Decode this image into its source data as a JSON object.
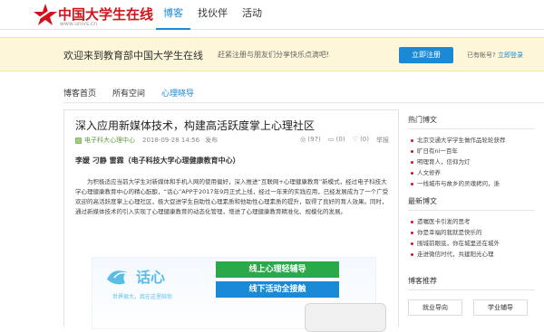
{
  "header": {
    "brand": "中国大学生在线",
    "url": "www.univs.cn",
    "nav": [
      {
        "label": "博客",
        "active": true
      },
      {
        "label": "找伙伴",
        "active": false
      },
      {
        "label": "活动",
        "active": false
      }
    ]
  },
  "banner": {
    "welcome": "欢迎来到教育部中国大学生在线",
    "subtext": "赶紧注册与朋友们分享快乐点滴吧!",
    "register_label": "立即注册",
    "login_prefix": "已有帐号?",
    "login_link": "立即登录"
  },
  "subnav": [
    {
      "label": "博客首页",
      "active": false
    },
    {
      "label": "所有空间",
      "active": false
    },
    {
      "label": "心理晓导",
      "active": true
    }
  ],
  "article": {
    "title": "深入应用新媒体技术，构建高活跃度掌上心理社区",
    "category": "电子科大心理中心",
    "date": "2018-09-28 14:56",
    "publish_label": "发布",
    "views": "(97)",
    "comments": "(0)",
    "likes": "(0)",
    "report_label": "举报",
    "authors": "李媛  刁静  雷霖（电子科技大学心理健康教育中心）",
    "body": "为积极适应当前大学生对新媒体和手机人网的使用偏好，深入推进“互联网+心理健康教育”新模式，经过电子科技大学心理健康教育中心的精心酝酿，“话心”APP于2017年9月正式上线，经过一年来的实践应用，已经发展成为了一个广受欢迎的高活跃度掌上心理社区，极大促进学生自助性心理素质和他助性心理素质的提升，取得了良好的育人效果。同时，通过新媒体技术的引入实现了心理健康教育的动态化管理，增进了心理健康教育精准化、规模化的发展。",
    "figure": {
      "app_name": "话心",
      "tagline": "世界很大，我在这里陪你",
      "btn_online": "线上心理轻辅导",
      "btn_offline": "线下活动全接触"
    }
  },
  "sidebar": {
    "hot_title": "热门博文",
    "hot": [
      "北京交通大学学生做作品轮轮获荐",
      "旷日有ni一百年",
      "明理育人，信仰为灯",
      "人文修养",
      "一线城市与故乡的灵魂拷问，浙"
    ],
    "latest_title": "最新博文",
    "latest": [
      "遗嘱医卡引发的思考",
      "你是幸福的我就是快乐的",
      "围城前眼底，你在城里还在城外",
      "走进微信时代，共建阳光心理"
    ],
    "rec_title": "博客推荐",
    "rec_buttons": [
      "就业导向",
      "学业辅导"
    ]
  }
}
